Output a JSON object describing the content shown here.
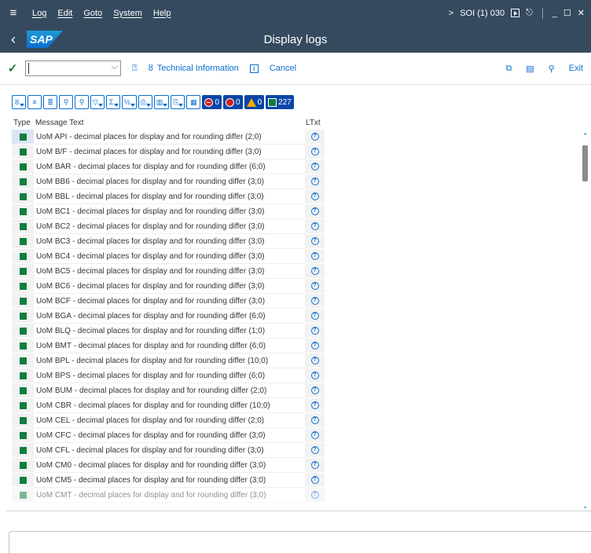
{
  "menubar": {
    "items": [
      "Log",
      "Edit",
      "Goto",
      "System",
      "Help"
    ],
    "system_info": "SOI (1) 030"
  },
  "titlebar": {
    "logo_text": "SAP",
    "title": "Display logs"
  },
  "toolbar": {
    "command_field_value": "",
    "technical_information": "Technical Information",
    "cancel": "Cancel",
    "exit": "Exit"
  },
  "alv_toolbar": {
    "error_count": "0",
    "stop_count": "0",
    "warning_count": "0",
    "success_count": "227"
  },
  "grid": {
    "columns": [
      "Type",
      "Message Text",
      "LTxt"
    ],
    "rows": [
      {
        "type": "success",
        "text": "UoM API - decimal places for display and for rounding differ (2;0)"
      },
      {
        "type": "success",
        "text": "UoM B/F - decimal places for display and for rounding differ (3;0)"
      },
      {
        "type": "success",
        "text": "UoM BAR - decimal places for display and for rounding differ (6;0)"
      },
      {
        "type": "success",
        "text": "UoM BB6 - decimal places for display and for rounding differ (3;0)"
      },
      {
        "type": "success",
        "text": "UoM BBL - decimal places for display and for rounding differ (3;0)"
      },
      {
        "type": "success",
        "text": "UoM BC1 - decimal places for display and for rounding differ (3;0)"
      },
      {
        "type": "success",
        "text": "UoM BC2 - decimal places for display and for rounding differ (3;0)"
      },
      {
        "type": "success",
        "text": "UoM BC3 - decimal places for display and for rounding differ (3;0)"
      },
      {
        "type": "success",
        "text": "UoM BC4 - decimal places for display and for rounding differ (3;0)"
      },
      {
        "type": "success",
        "text": "UoM BC5 - decimal places for display and for rounding differ (3;0)"
      },
      {
        "type": "success",
        "text": "UoM BC6 - decimal places for display and for rounding differ (3;0)"
      },
      {
        "type": "success",
        "text": "UoM BCF - decimal places for display and for rounding differ (3;0)"
      },
      {
        "type": "success",
        "text": "UoM BGA - decimal places for display and for rounding differ (6;0)"
      },
      {
        "type": "success",
        "text": "UoM BLQ - decimal places for display and for rounding differ (1;0)"
      },
      {
        "type": "success",
        "text": "UoM BMT - decimal places for display and for rounding differ (6;0)"
      },
      {
        "type": "success",
        "text": "UoM BPL - decimal places for display and for rounding differ (10;0)"
      },
      {
        "type": "success",
        "text": "UoM BPS - decimal places for display and for rounding differ (6;0)"
      },
      {
        "type": "success",
        "text": "UoM BUM - decimal places for display and for rounding differ (2;0)"
      },
      {
        "type": "success",
        "text": "UoM CBR - decimal places for display and for rounding differ (10;0)"
      },
      {
        "type": "success",
        "text": "UoM CEL - decimal places for display and for rounding differ (2;0)"
      },
      {
        "type": "success",
        "text": "UoM CFC - decimal places for display and for rounding differ (3;0)"
      },
      {
        "type": "success",
        "text": "UoM CFL - decimal places for display and for rounding differ (3;0)"
      },
      {
        "type": "success",
        "text": "UoM CM0 - decimal places for display and for rounding differ (3;0)"
      },
      {
        "type": "success",
        "text": "UoM CM5 - decimal places for display and for rounding differ (3;0)"
      },
      {
        "type": "success",
        "text": "UoM CMT - decimal places for display and for rounding differ (3;0)"
      }
    ]
  },
  "colors": {
    "shell": "#354a5f",
    "accent": "#0a6ed1",
    "success": "#107e3e",
    "error": "#d02020",
    "warning": "#f0ab00"
  },
  "statusbar": {
    "message": ""
  }
}
